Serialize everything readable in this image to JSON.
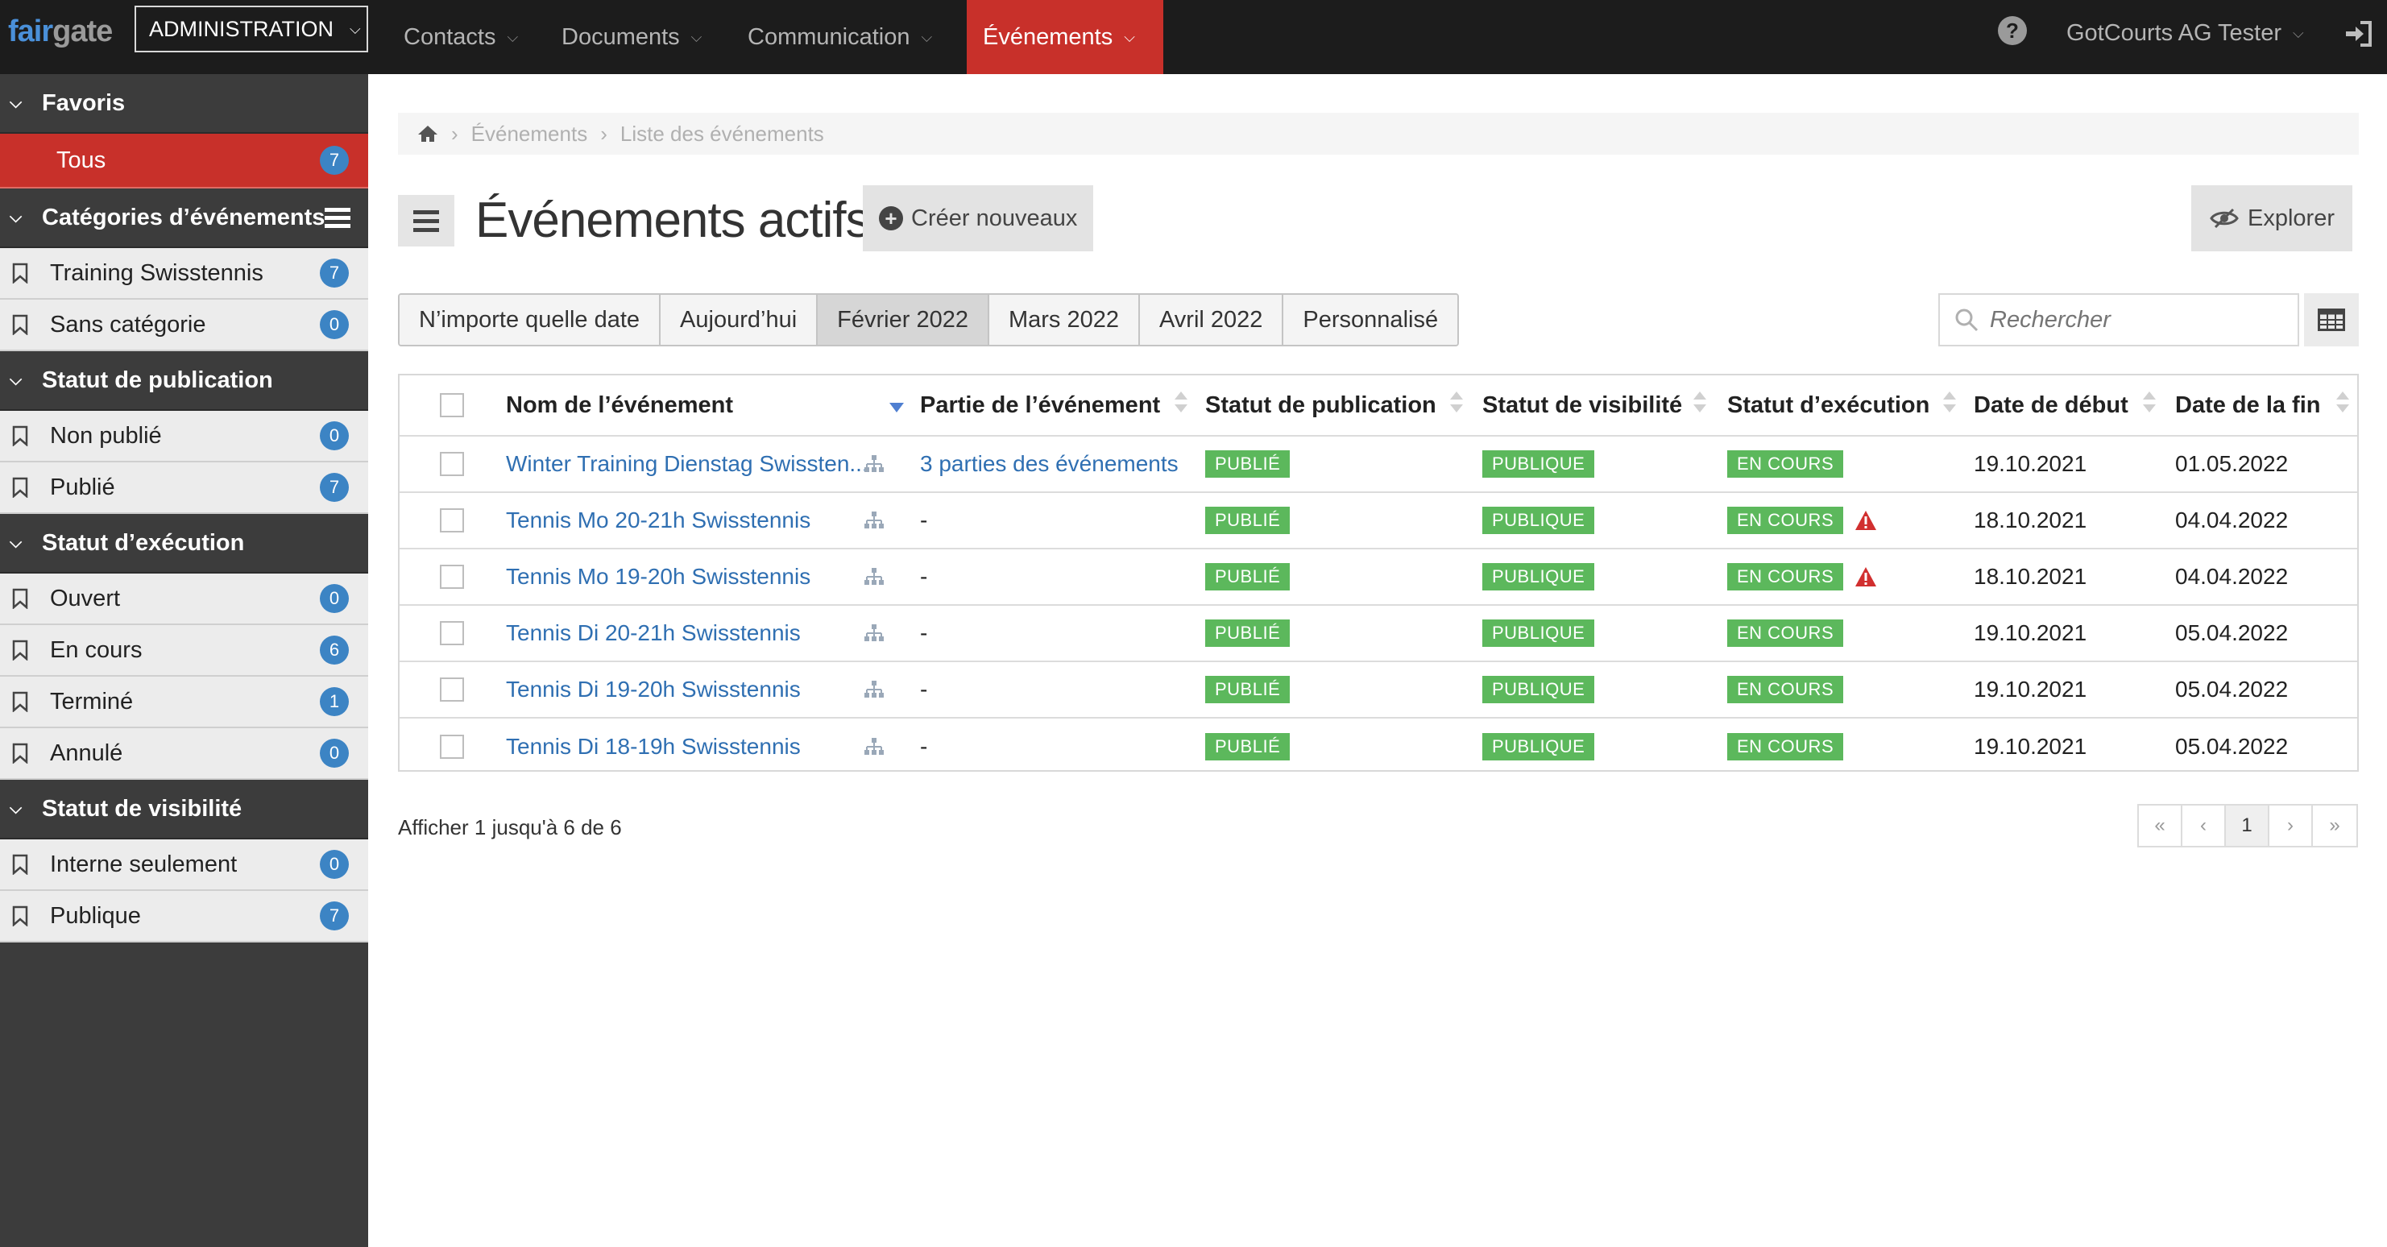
{
  "topbar": {
    "logo_left": "fair",
    "logo_right": "gate",
    "admin_label": "ADMINISTRATION",
    "nav": [
      {
        "label": "Contacts",
        "active": false
      },
      {
        "label": "Documents",
        "active": false
      },
      {
        "label": "Communication",
        "active": false
      },
      {
        "label": "Événements",
        "active": true
      }
    ],
    "user": "GotCourts AG Tester"
  },
  "sidebar": {
    "favoris": {
      "title": "Favoris",
      "items": [
        {
          "label": "Tous",
          "count": "7"
        }
      ]
    },
    "categories": {
      "title": "Catégories d’événements",
      "items": [
        {
          "label": "Training Swisstennis",
          "count": "7"
        },
        {
          "label": "Sans catégorie",
          "count": "0"
        }
      ]
    },
    "publication": {
      "title": "Statut de publication",
      "items": [
        {
          "label": "Non publié",
          "count": "0"
        },
        {
          "label": "Publié",
          "count": "7"
        }
      ]
    },
    "execution": {
      "title": "Statut d’exécution",
      "items": [
        {
          "label": "Ouvert",
          "count": "0"
        },
        {
          "label": "En cours",
          "count": "6"
        },
        {
          "label": "Terminé",
          "count": "1"
        },
        {
          "label": "Annulé",
          "count": "0"
        }
      ]
    },
    "visibility": {
      "title": "Statut de visibilité",
      "items": [
        {
          "label": "Interne seulement",
          "count": "0"
        },
        {
          "label": "Publique",
          "count": "7"
        }
      ]
    }
  },
  "breadcrumb": [
    "Événements",
    "Liste des événements"
  ],
  "page": {
    "title": "Événements actifs",
    "create_label": "Créer nouveaux",
    "explore_label": "Explorer"
  },
  "date_filters": [
    {
      "label": "N’importe quelle date",
      "active": false
    },
    {
      "label": "Aujourd’hui",
      "active": false
    },
    {
      "label": "Février 2022",
      "active": true
    },
    {
      "label": "Mars 2022",
      "active": false
    },
    {
      "label": "Avril 2022",
      "active": false
    },
    {
      "label": "Personnalisé",
      "active": false
    }
  ],
  "search": {
    "placeholder": "Rechercher"
  },
  "table": {
    "columns": [
      "Nom de l’événement",
      "Partie de l’événement",
      "Statut de publication",
      "Statut de visibilité",
      "Statut d’exécution",
      "Date de début",
      "Date de la fin"
    ],
    "rows": [
      {
        "name": "Winter Training Dienstag Swissten...",
        "part": "3 parties des événements",
        "pub": "PUBLIÉ",
        "vis": "PUBLIQUE",
        "exec": "EN COURS",
        "warn": false,
        "start": "19.10.2021",
        "end": "01.05.2022"
      },
      {
        "name": "Tennis Mo 20-21h Swisstennis",
        "part": "-",
        "pub": "PUBLIÉ",
        "vis": "PUBLIQUE",
        "exec": "EN COURS",
        "warn": true,
        "start": "18.10.2021",
        "end": "04.04.2022"
      },
      {
        "name": "Tennis Mo 19-20h Swisstennis",
        "part": "-",
        "pub": "PUBLIÉ",
        "vis": "PUBLIQUE",
        "exec": "EN COURS",
        "warn": true,
        "start": "18.10.2021",
        "end": "04.04.2022"
      },
      {
        "name": "Tennis Di 20-21h Swisstennis",
        "part": "-",
        "pub": "PUBLIÉ",
        "vis": "PUBLIQUE",
        "exec": "EN COURS",
        "warn": false,
        "start": "19.10.2021",
        "end": "05.04.2022"
      },
      {
        "name": "Tennis Di 19-20h Swisstennis",
        "part": "-",
        "pub": "PUBLIÉ",
        "vis": "PUBLIQUE",
        "exec": "EN COURS",
        "warn": false,
        "start": "19.10.2021",
        "end": "05.04.2022"
      },
      {
        "name": "Tennis Di 18-19h Swisstennis",
        "part": "-",
        "pub": "PUBLIÉ",
        "vis": "PUBLIQUE",
        "exec": "EN COURS",
        "warn": false,
        "start": "19.10.2021",
        "end": "05.04.2022"
      }
    ]
  },
  "footer": {
    "info": "Afficher 1 jusqu'à 6 de 6"
  },
  "pager": {
    "first": "«",
    "prev": "‹",
    "current": "1",
    "next": "›",
    "last": "»"
  },
  "colors": {
    "accent": "#c8302a",
    "badge": "#3c84c4",
    "tag": "#5cb85c",
    "link": "#2f6fb2"
  }
}
